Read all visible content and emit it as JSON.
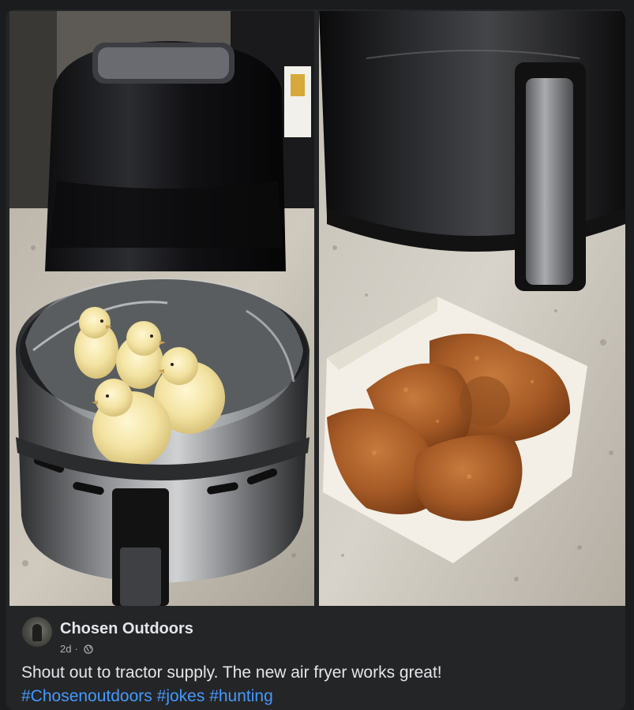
{
  "post": {
    "author": "Chosen Outdoors",
    "timestamp": "2d",
    "separator": "·",
    "text": "Shout out to tractor supply. The new air fryer works great!",
    "hashtags": [
      "#Chosenoutdoors",
      "#jokes",
      "#hunting"
    ],
    "images": [
      {
        "icon": "air-fryer-with-chicks-image"
      },
      {
        "icon": "air-fryer-with-fried-chicken-image"
      }
    ]
  },
  "colors": {
    "background": "#1b1c1e",
    "card": "#242526",
    "primary_text": "#e4e6eb",
    "secondary_text": "#b0b3b8",
    "link": "#4599ff"
  }
}
